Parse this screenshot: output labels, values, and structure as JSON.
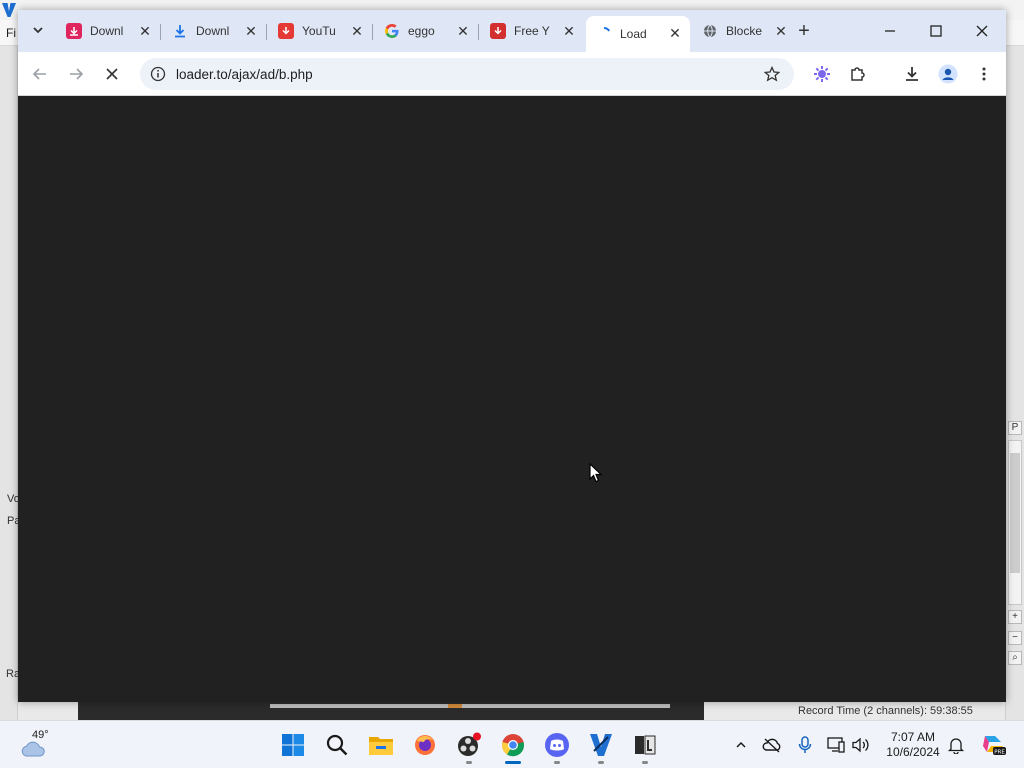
{
  "background_app": {
    "menu_label": "Fi",
    "left_labels": [
      "Vo",
      "Pa",
      "Ra"
    ],
    "status_text": "Record Time (2 channels): 59:38:55"
  },
  "browser": {
    "tabs": [
      {
        "label": "Downl",
        "favicon": "download-red-icon",
        "color": "#e0245e",
        "active": false
      },
      {
        "label": "Downl",
        "favicon": "download-blue-icon",
        "color": "#1a73e8",
        "active": false
      },
      {
        "label": "YouTu",
        "favicon": "youtube-download-icon",
        "color": "#e53935",
        "active": false
      },
      {
        "label": "eggo",
        "favicon": "google-icon",
        "color": "#4285f4",
        "active": false
      },
      {
        "label": "Free Y",
        "favicon": "download-red-icon",
        "color": "#d32f2f",
        "active": false
      },
      {
        "label": "Load",
        "favicon": "loading-spinner-icon",
        "color": "#1a73e8",
        "active": true
      },
      {
        "label": "Blocke",
        "favicon": "globe-icon",
        "color": "#5f6368",
        "active": false
      }
    ],
    "new_tab_label": "+",
    "url": "loader.to/ajax/ad/b.php",
    "page_background": "#212121"
  },
  "taskbar": {
    "weather_temp": "49°",
    "time": "7:07 AM",
    "date": "10/6/2024",
    "apps": [
      {
        "name": "windows-start-icon"
      },
      {
        "name": "search-icon"
      },
      {
        "name": "file-explorer-icon"
      },
      {
        "name": "firefox-icon"
      },
      {
        "name": "obs-icon"
      },
      {
        "name": "chrome-icon"
      },
      {
        "name": "discord-icon"
      },
      {
        "name": "vegas-icon"
      },
      {
        "name": "libretranslate-icon"
      }
    ]
  }
}
